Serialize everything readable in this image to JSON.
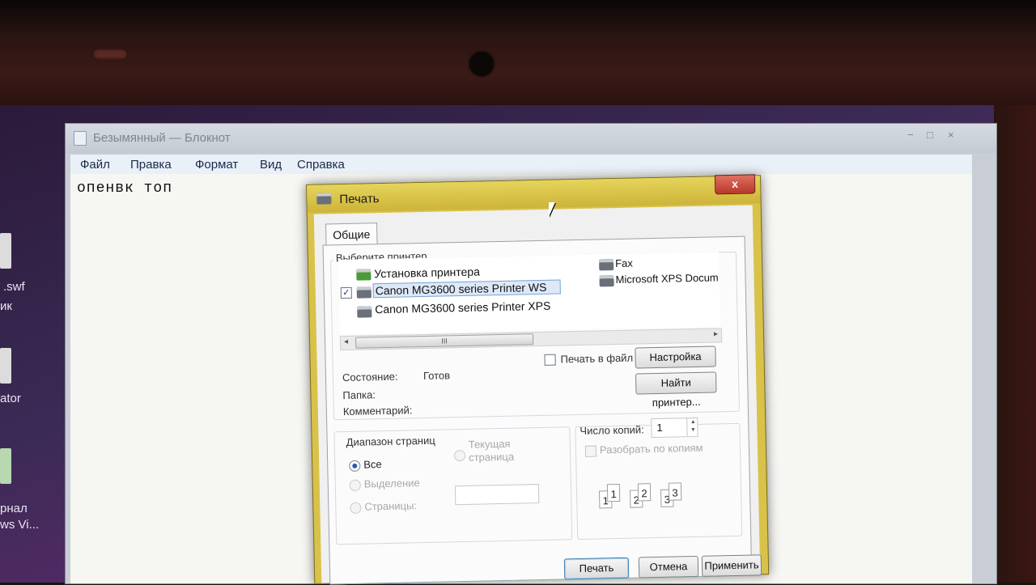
{
  "desktop": {
    "labels": [
      ".swf",
      "ик",
      "ator",
      "рнал",
      "ws Vi..."
    ]
  },
  "notepad": {
    "title": "Безымянный — Блокнот",
    "menu": [
      "Файл",
      "Правка",
      "Формат",
      "Вид",
      "Справка"
    ],
    "content": "опенвк топ",
    "win_controls": [
      "−",
      "□",
      "×"
    ]
  },
  "print_dialog": {
    "title": "Печать",
    "close_label": "x",
    "tab_general": "Общие",
    "select_printer_label": "Выберите принтер",
    "printers_left": [
      {
        "name": "Установка принтера",
        "icon": "add-printer-icon",
        "selected": false
      },
      {
        "name": "Canon MG3600 series Printer WS",
        "icon": "printer-icon",
        "selected": true
      },
      {
        "name": "Canon MG3600 series Printer XPS",
        "icon": "printer-icon",
        "selected": false
      }
    ],
    "printers_right": [
      {
        "name": "Fax",
        "icon": "fax-icon"
      },
      {
        "name": "Microsoft XPS Docum",
        "icon": "printer-icon"
      }
    ],
    "scroll_thumb": "III",
    "print_to_file_label": "Печать в файл",
    "preferences_button": "Настройка",
    "find_printer_button": "Найти принтер...",
    "status_label": "Состояние:",
    "status_value": "Готов",
    "location_label": "Папка:",
    "comment_label": "Комментарий:",
    "page_range_label": "Диапазон страниц",
    "range_all": "Все",
    "range_selection": "Выделение",
    "range_current_line1": "Текущая",
    "range_current_line2": "страница",
    "range_pages": "Страницы:",
    "copies_label": "Число копий:",
    "copies_value": "1",
    "collate_label": "Разобрать по копиям",
    "collate_pages": [
      "1",
      "1",
      "2",
      "2",
      "3",
      "3"
    ],
    "print_button": "Печать",
    "cancel_button": "Отмена",
    "apply_button": "Применить",
    "accent": "#d8c24a"
  }
}
